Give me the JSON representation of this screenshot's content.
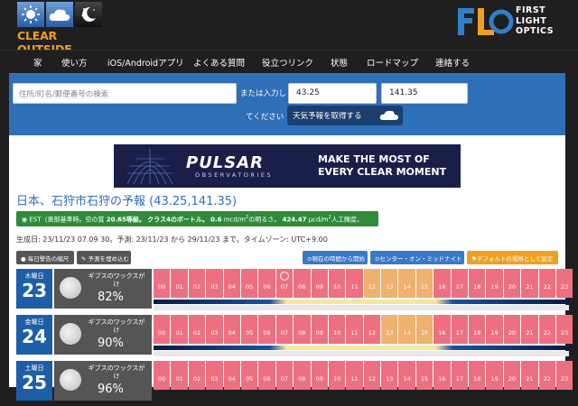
{
  "header": {
    "app_logo_text": "CLEAR OUTSIDE",
    "partner_logo_mark": "FLO",
    "partner_logo_words": [
      "FIRST",
      "LIGHT",
      "OPTICS"
    ]
  },
  "nav": {
    "items": [
      "家",
      "使い方",
      "iOS/Androidアプリ",
      "よくある質問",
      "役立つリンク",
      "状態",
      "ロードマップ",
      "連絡する"
    ]
  },
  "search": {
    "placeholder": "住所/町名/郵便番号の検索",
    "or_label": "または入力し",
    "please_label": "てください",
    "lat_value": "43.25",
    "lon_value": "141.35",
    "forecast_button": "天気予報を取得する"
  },
  "banner": {
    "brand": "PULSAR",
    "sub": "OBSERVATORIES",
    "line1": "MAKE THE MOST OF",
    "line2": "EVERY CLEAR MOMENT"
  },
  "forecast": {
    "title": "日本、石狩市石狩の予報 (43.25,141.35)",
    "badge_prefix": "EST（東部基準時。空の質",
    "badge_sqm": "20.65等級。",
    "badge_class": "クラス4のボートル。",
    "badge_mcd": "0.6",
    "badge_mcd_unit": "mcd/m",
    "badge_mid": "の明るさ。",
    "badge_ucd": "424.47",
    "badge_ucd_unit": "µcd/m",
    "badge_tail": "人工輝度。",
    "generated": "生成日: 23/11/23 07.09 30。予測: 23/11/23 から 29/11/23 まで。タイムゾーン: UTC+9.00"
  },
  "buttons": {
    "summary": "毎日警告の縮尺",
    "details": "予測を埋め込む",
    "current": "現在の時間から開始",
    "center": "センター・オン・ミッドナイト",
    "default": "デフォルトの場所として設定"
  },
  "days": [
    {
      "dow": "木曜日",
      "date": "23",
      "phase": "ギブスのワックスがけ",
      "illum": "82%"
    },
    {
      "dow": "金曜日",
      "date": "24",
      "phase": "ギブスのワックスがけ",
      "illum": "90%"
    },
    {
      "dow": "土曜日",
      "date": "25",
      "phase": "ギブスのワックスがけ",
      "illum": "96%"
    }
  ],
  "hour_labels": [
    "00",
    "01",
    "02",
    "03",
    "04",
    "05",
    "06",
    "07",
    "08",
    "09",
    "10",
    "11",
    "12",
    "13",
    "14",
    "15",
    "16",
    "17",
    "18",
    "19",
    "20",
    "21",
    "22",
    "23"
  ],
  "colors": {
    "accent_blue": "#2f6fb8",
    "cloudy_red": "#ee7080",
    "partly_amber": "#f0b070",
    "badge_green": "#2e8b3a",
    "brand_orange": "#f0a020"
  }
}
